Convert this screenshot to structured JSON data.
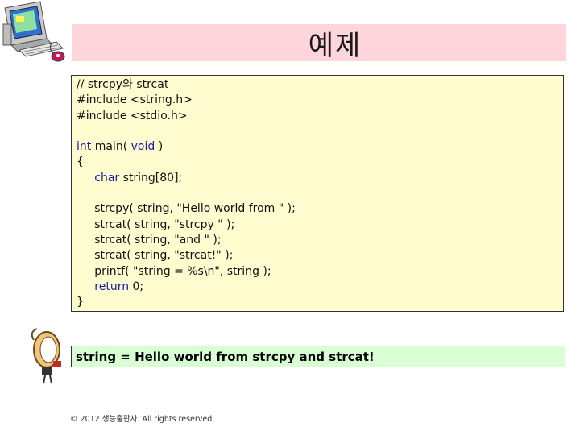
{
  "slide": {
    "title": "예제"
  },
  "code": {
    "lines": [
      {
        "parts": [
          {
            "t": "// strcpy와 strcat",
            "k": false
          }
        ]
      },
      {
        "parts": [
          {
            "t": "#include <string.h>",
            "k": false
          }
        ]
      },
      {
        "parts": [
          {
            "t": "#include <stdio.h>",
            "k": false
          }
        ]
      },
      {
        "parts": [
          {
            "t": "",
            "k": false
          }
        ]
      },
      {
        "parts": [
          {
            "t": "int",
            "k": true
          },
          {
            "t": " main( ",
            "k": false
          },
          {
            "t": "void",
            "k": true
          },
          {
            "t": " )",
            "k": false
          }
        ]
      },
      {
        "parts": [
          {
            "t": "{",
            "k": false
          }
        ]
      },
      {
        "parts": [
          {
            "t": "     ",
            "k": false
          },
          {
            "t": "char",
            "k": true
          },
          {
            "t": " string[80];",
            "k": false
          }
        ]
      },
      {
        "parts": [
          {
            "t": "",
            "k": false
          }
        ]
      },
      {
        "parts": [
          {
            "t": "     strcpy( string, \"Hello world from \" );",
            "k": false
          }
        ]
      },
      {
        "parts": [
          {
            "t": "     strcat( string, \"strcpy \" );",
            "k": false
          }
        ]
      },
      {
        "parts": [
          {
            "t": "     strcat( string, \"and \" );",
            "k": false
          }
        ]
      },
      {
        "parts": [
          {
            "t": "     strcat( string, \"strcat!\" );",
            "k": false
          }
        ]
      },
      {
        "parts": [
          {
            "t": "     printf( \"string = %s\\n\", string );",
            "k": false
          }
        ]
      },
      {
        "parts": [
          {
            "t": "     ",
            "k": false
          },
          {
            "t": "return",
            "k": true
          },
          {
            "t": " 0;",
            "k": false
          }
        ]
      },
      {
        "parts": [
          {
            "t": "}",
            "k": false
          }
        ]
      }
    ]
  },
  "output": {
    "text": "string = Hello world from strcpy and strcat!"
  },
  "footer": {
    "text": "© 2012 생능출판사  All rights reserved"
  },
  "colors": {
    "title_bg": "#ffd5dc",
    "code_bg": "#fffcd0",
    "output_bg": "#d9ffd5",
    "keyword": "#1a1aa6"
  },
  "icons": {
    "top_left": "computer-icon",
    "bottom_left": "figure-icon"
  }
}
